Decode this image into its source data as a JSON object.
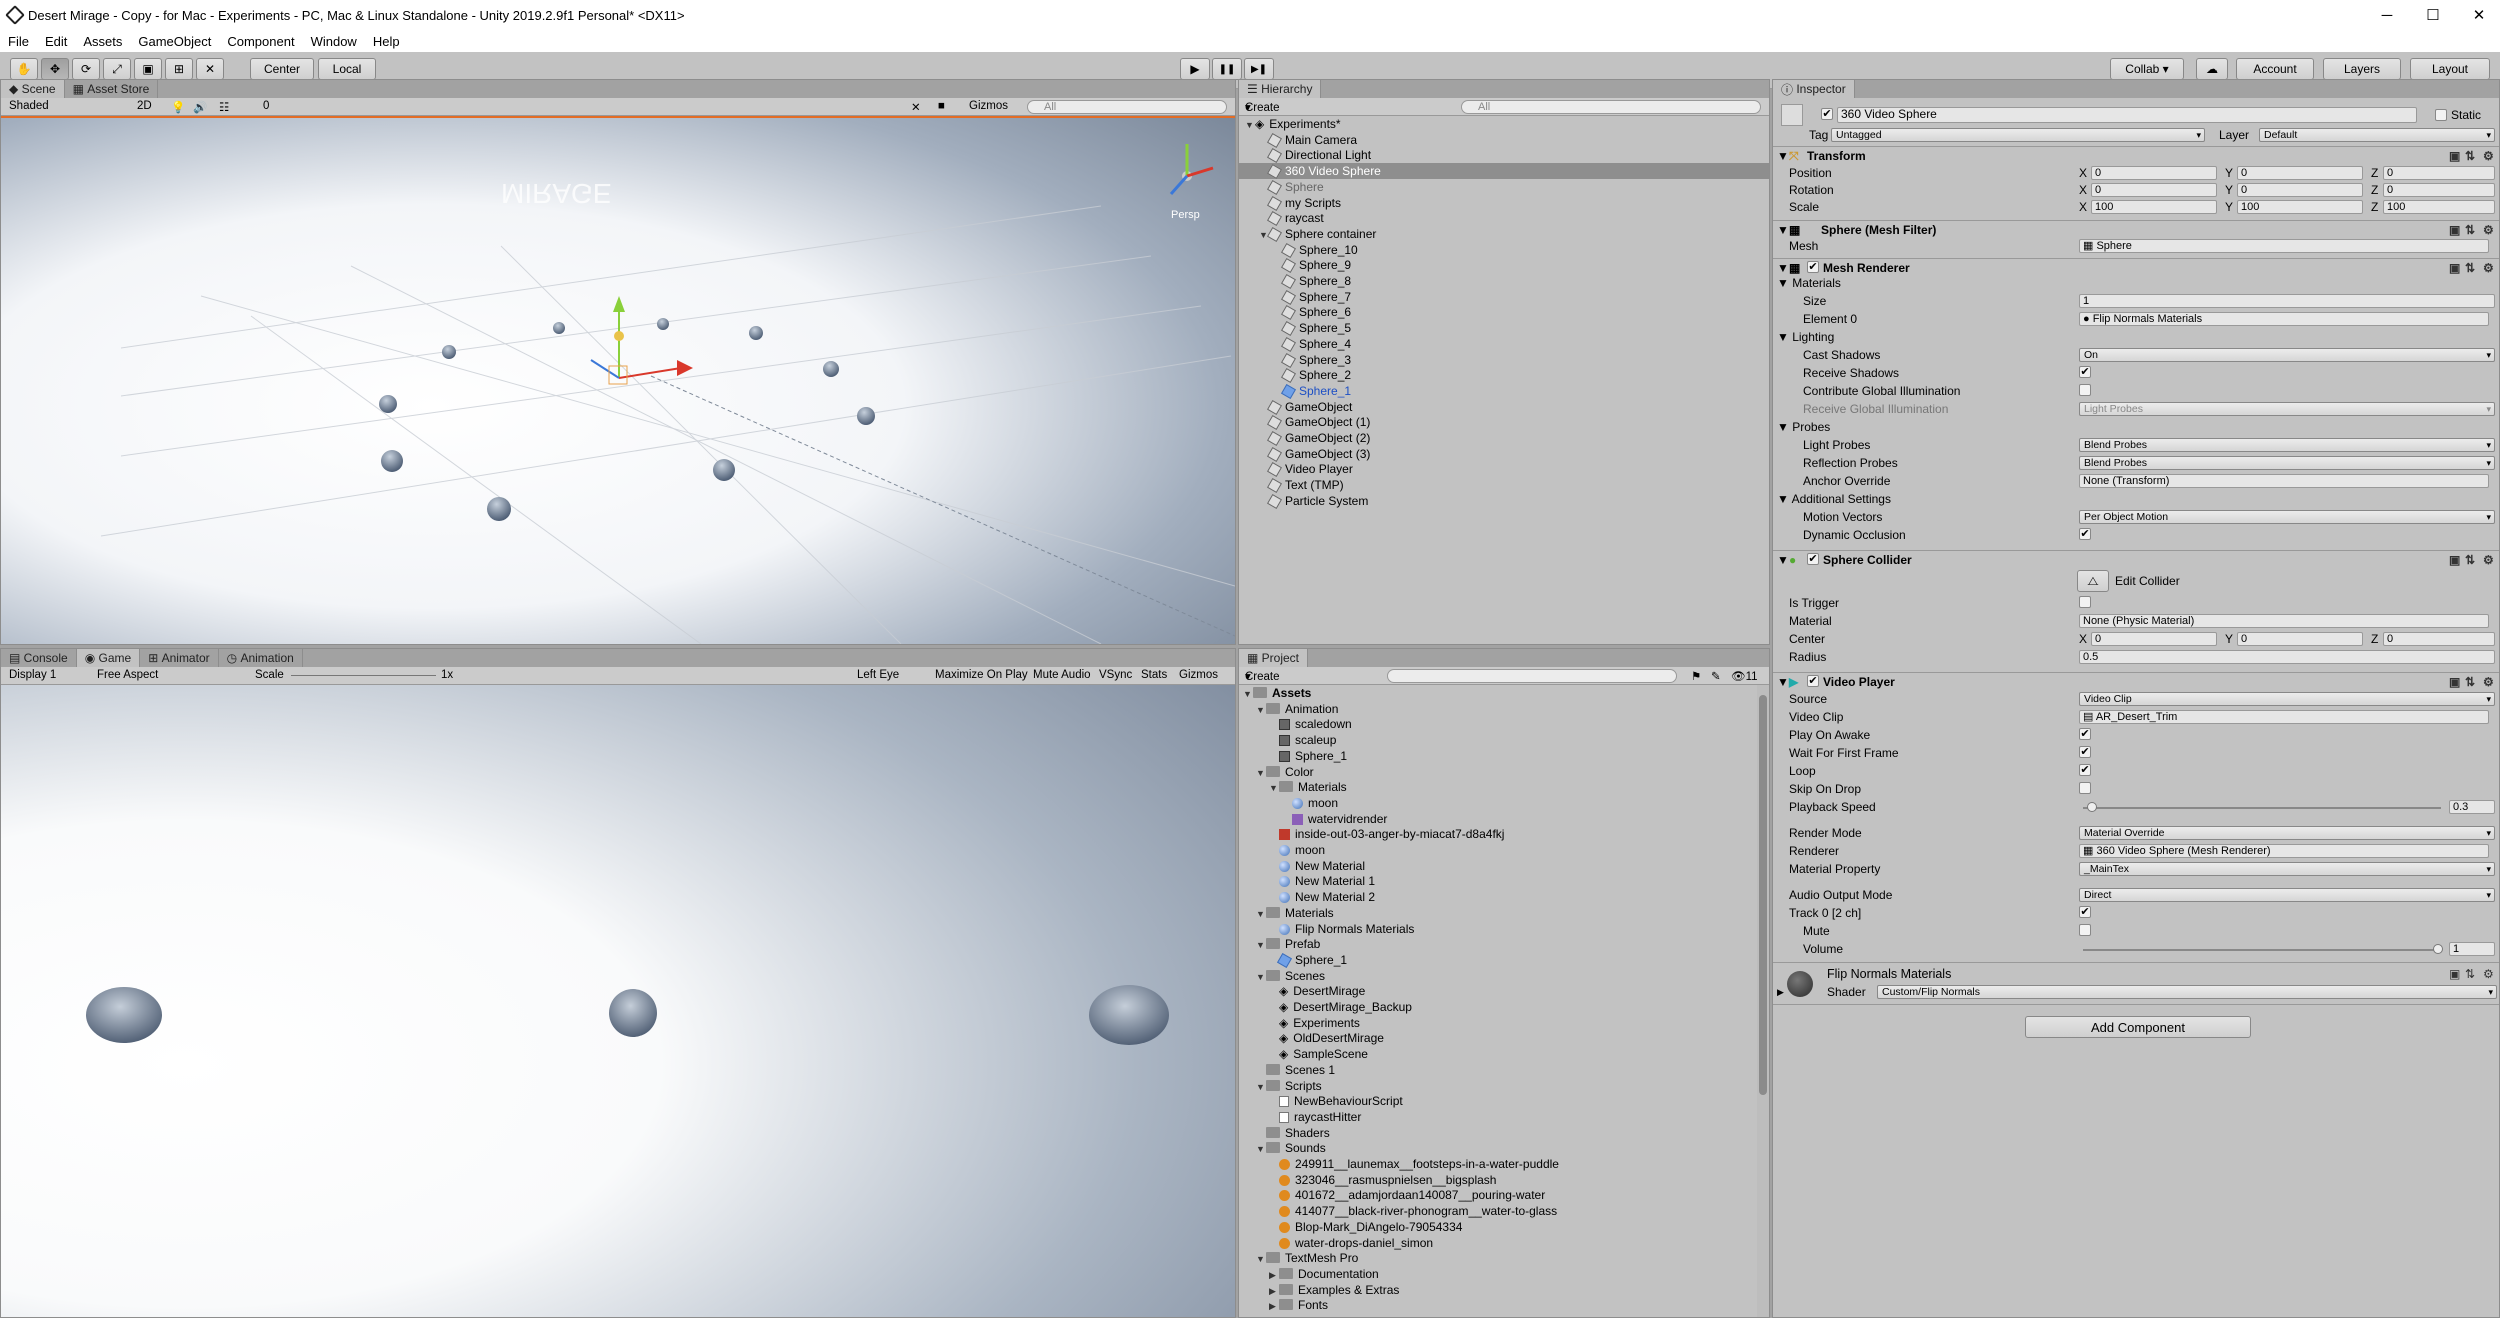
{
  "window": {
    "title": "Desert Mirage - Copy - for Mac - Experiments - PC, Mac & Linux Standalone - Unity 2019.2.9f1 Personal* <DX11>",
    "minimize": "─",
    "maximize": "☐",
    "close": "✕"
  },
  "menu": [
    "File",
    "Edit",
    "Assets",
    "GameObject",
    "Component",
    "Window",
    "Help"
  ],
  "toolbar": {
    "pivot": "Center",
    "space": "Local",
    "play": "▶",
    "pause": "❚❚",
    "step": "▶❚",
    "collab": "Collab ▾",
    "cloud": "☁",
    "account": "Account",
    "layers": "Layers",
    "layout": "Layout"
  },
  "scene": {
    "tabs": [
      "Scene",
      "Asset Store"
    ],
    "shading": "Shaded",
    "mode2d": "2D",
    "effects_count": "0",
    "gizmos": "Gizmos",
    "search_placeholder": "All",
    "persp": "Persp",
    "mirage": "MIRAGE"
  },
  "game": {
    "tabs": [
      "Console",
      "Game",
      "Animator",
      "Animation"
    ],
    "display": "Display 1",
    "aspect": "Free Aspect",
    "scale_label": "Scale",
    "scale_value": "1x",
    "eye": "Left Eye",
    "buttons": [
      "Maximize On Play",
      "Mute Audio",
      "VSync",
      "Stats",
      "Gizmos"
    ]
  },
  "hierarchy": {
    "tab": "Hierarchy",
    "create": "Create",
    "search_placeholder": "All",
    "rows": [
      {
        "label": "Experiments*",
        "indent": 0,
        "type": "scene",
        "arrow": "▼"
      },
      {
        "label": "Main Camera",
        "indent": 1,
        "type": "obj"
      },
      {
        "label": "Directional Light",
        "indent": 1,
        "type": "obj"
      },
      {
        "label": "360 Video Sphere",
        "indent": 1,
        "type": "obj",
        "selected": true
      },
      {
        "label": "Sphere",
        "indent": 1,
        "type": "obj",
        "dim": true
      },
      {
        "label": "my Scripts",
        "indent": 1,
        "type": "obj"
      },
      {
        "label": "raycast",
        "indent": 1,
        "type": "obj"
      },
      {
        "label": "Sphere container",
        "indent": 1,
        "type": "obj",
        "arrow": "▼"
      },
      {
        "label": "Sphere_10",
        "indent": 2,
        "type": "obj"
      },
      {
        "label": "Sphere_9",
        "indent": 2,
        "type": "obj"
      },
      {
        "label": "Sphere_8",
        "indent": 2,
        "type": "obj"
      },
      {
        "label": "Sphere_7",
        "indent": 2,
        "type": "obj"
      },
      {
        "label": "Sphere_6",
        "indent": 2,
        "type": "obj"
      },
      {
        "label": "Sphere_5",
        "indent": 2,
        "type": "obj"
      },
      {
        "label": "Sphere_4",
        "indent": 2,
        "type": "obj"
      },
      {
        "label": "Sphere_3",
        "indent": 2,
        "type": "obj"
      },
      {
        "label": "Sphere_2",
        "indent": 2,
        "type": "obj"
      },
      {
        "label": "Sphere_1",
        "indent": 2,
        "type": "prefab",
        "blue": true
      },
      {
        "label": "GameObject",
        "indent": 1,
        "type": "obj"
      },
      {
        "label": "GameObject (1)",
        "indent": 1,
        "type": "obj"
      },
      {
        "label": "GameObject (2)",
        "indent": 1,
        "type": "obj"
      },
      {
        "label": "GameObject (3)",
        "indent": 1,
        "type": "obj"
      },
      {
        "label": "Video Player",
        "indent": 1,
        "type": "obj"
      },
      {
        "label": "Text (TMP)",
        "indent": 1,
        "type": "obj"
      },
      {
        "label": "Particle System",
        "indent": 1,
        "type": "obj"
      }
    ]
  },
  "project": {
    "tab": "Project",
    "create": "Create",
    "count": "11",
    "rows": [
      {
        "label": "Assets",
        "indent": 0,
        "type": "folder",
        "arrow": "▼",
        "bold": true
      },
      {
        "label": "Animation",
        "indent": 1,
        "type": "folder",
        "arrow": "▼"
      },
      {
        "label": "scaledown",
        "indent": 2,
        "type": "anim"
      },
      {
        "label": "scaleup",
        "indent": 2,
        "type": "anim"
      },
      {
        "label": "Sphere_1",
        "indent": 2,
        "type": "anim"
      },
      {
        "label": "Color",
        "indent": 1,
        "type": "folder",
        "arrow": "▼"
      },
      {
        "label": "Materials",
        "indent": 2,
        "type": "folder",
        "arrow": "▼"
      },
      {
        "label": "moon",
        "indent": 3,
        "type": "mat"
      },
      {
        "label": "watervidrender",
        "indent": 3,
        "type": "rt"
      },
      {
        "label": "inside-out-03-anger-by-miacat7-d8a4fkj",
        "indent": 2,
        "type": "img"
      },
      {
        "label": "moon",
        "indent": 2,
        "type": "mat"
      },
      {
        "label": "New Material",
        "indent": 2,
        "type": "mat"
      },
      {
        "label": "New Material 1",
        "indent": 2,
        "type": "mat"
      },
      {
        "label": "New Material 2",
        "indent": 2,
        "type": "mat"
      },
      {
        "label": "Materials",
        "indent": 1,
        "type": "folder",
        "arrow": "▼"
      },
      {
        "label": "Flip Normals Materials",
        "indent": 2,
        "type": "mat"
      },
      {
        "label": "Prefab",
        "indent": 1,
        "type": "folder",
        "arrow": "▼"
      },
      {
        "label": "Sphere_1",
        "indent": 2,
        "type": "prefab"
      },
      {
        "label": "Scenes",
        "indent": 1,
        "type": "folder",
        "arrow": "▼"
      },
      {
        "label": "DesertMirage",
        "indent": 2,
        "type": "scene"
      },
      {
        "label": "DesertMirage_Backup",
        "indent": 2,
        "type": "scene"
      },
      {
        "label": "Experiments",
        "indent": 2,
        "type": "scene"
      },
      {
        "label": "OldDesertMirage",
        "indent": 2,
        "type": "scene"
      },
      {
        "label": "SampleScene",
        "indent": 2,
        "type": "scene"
      },
      {
        "label": "Scenes 1",
        "indent": 1,
        "type": "folder"
      },
      {
        "label": "Scripts",
        "indent": 1,
        "type": "folder",
        "arrow": "▼"
      },
      {
        "label": "NewBehaviourScript",
        "indent": 2,
        "type": "script"
      },
      {
        "label": "raycastHitter",
        "indent": 2,
        "type": "script"
      },
      {
        "label": "Shaders",
        "indent": 1,
        "type": "folder"
      },
      {
        "label": "Sounds",
        "indent": 1,
        "type": "folder",
        "arrow": "▼"
      },
      {
        "label": "249911__launemax__footsteps-in-a-water-puddle",
        "indent": 2,
        "type": "audio"
      },
      {
        "label": "323046__rasmuspnielsen__bigsplash",
        "indent": 2,
        "type": "audio"
      },
      {
        "label": "401672__adamjordaan140087__pouring-water",
        "indent": 2,
        "type": "audio"
      },
      {
        "label": "414077__black-river-phonogram__water-to-glass",
        "indent": 2,
        "type": "audio"
      },
      {
        "label": "Blop-Mark_DiAngelo-79054334",
        "indent": 2,
        "type": "audio"
      },
      {
        "label": "water-drops-daniel_simon",
        "indent": 2,
        "type": "audio"
      },
      {
        "label": "TextMesh Pro",
        "indent": 1,
        "type": "folder",
        "arrow": "▼"
      },
      {
        "label": "Documentation",
        "indent": 2,
        "type": "folder",
        "arrow": "▶"
      },
      {
        "label": "Examples & Extras",
        "indent": 2,
        "type": "folder",
        "arrow": "▶"
      },
      {
        "label": "Fonts",
        "indent": 2,
        "type": "folder",
        "arrow": "▶"
      }
    ]
  },
  "inspector": {
    "tab": "Inspector",
    "name": "360 Video Sphere",
    "static": "Static",
    "tag_label": "Tag",
    "tag": "Untagged",
    "layer_label": "Layer",
    "layer": "Default",
    "transform": {
      "title": "Transform",
      "position": "Position",
      "rotation": "Rotation",
      "scale": "Scale",
      "pos": [
        "0",
        "0",
        "0"
      ],
      "rot": [
        "0",
        "0",
        "0"
      ],
      "scl": [
        "100",
        "100",
        "100"
      ]
    },
    "meshfilter": {
      "title": "Sphere (Mesh Filter)",
      "mesh_label": "Mesh",
      "mesh": "Sphere"
    },
    "meshrenderer": {
      "title": "Mesh Renderer",
      "materials": "Materials",
      "size_label": "Size",
      "size": "1",
      "element0_label": "Element 0",
      "element0": "Flip Normals Materials",
      "lighting": "Lighting",
      "cast_shadows_label": "Cast Shadows",
      "cast_shadows": "On",
      "receive_shadows": "Receive Shadows",
      "contribute_gi": "Contribute Global Illumination",
      "receive_gi_label": "Receive Global Illumination",
      "receive_gi": "Light Probes",
      "probes": "Probes",
      "light_probes_label": "Light Probes",
      "light_probes": "Blend Probes",
      "reflection_probes_label": "Reflection Probes",
      "reflection_probes": "Blend Probes",
      "anchor_label": "Anchor Override",
      "anchor": "None (Transform)",
      "additional": "Additional Settings",
      "motion_label": "Motion Vectors",
      "motion": "Per Object Motion",
      "dynamic_occlusion": "Dynamic Occlusion"
    },
    "collider": {
      "title": "Sphere Collider",
      "edit": "Edit Collider",
      "is_trigger": "Is Trigger",
      "material_label": "Material",
      "material": "None (Physic Material)",
      "center_label": "Center",
      "center": [
        "0",
        "0",
        "0"
      ],
      "radius_label": "Radius",
      "radius": "0.5"
    },
    "video": {
      "title": "Video Player",
      "source_label": "Source",
      "source": "Video Clip",
      "clip_label": "Video Clip",
      "clip": "AR_Desert_Trim",
      "play_on_awake": "Play On Awake",
      "wait_first": "Wait For First Frame",
      "loop": "Loop",
      "skip_drop": "Skip On Drop",
      "speed_label": "Playback Speed",
      "speed": "0.3",
      "render_mode_label": "Render Mode",
      "render_mode": "Material Override",
      "renderer_label": "Renderer",
      "renderer": "360 Video Sphere (Mesh Renderer)",
      "mat_prop_label": "Material Property",
      "mat_prop": "_MainTex",
      "audio_mode_label": "Audio Output Mode",
      "audio_mode": "Direct",
      "track0": "Track 0 [2 ch]",
      "mute": "Mute",
      "volume_label": "Volume",
      "volume": "1"
    },
    "material": {
      "name": "Flip Normals Materials",
      "shader_label": "Shader",
      "shader": "Custom/Flip Normals"
    },
    "add_component": "Add Component"
  }
}
